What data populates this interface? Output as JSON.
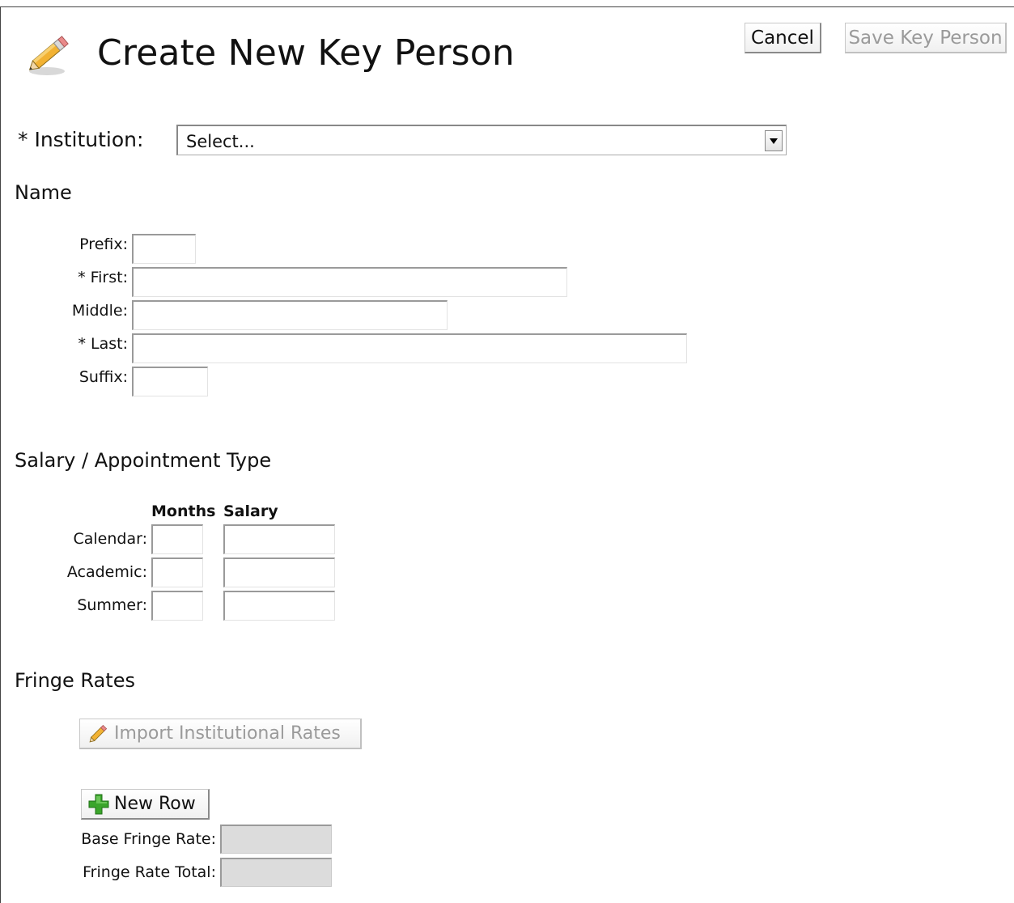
{
  "header": {
    "title": "Create New Key Person",
    "cancel_label": "Cancel",
    "save_label": "Save Key Person"
  },
  "institution": {
    "label": "* Institution:",
    "selected": "Select..."
  },
  "name_section": {
    "heading": "Name",
    "fields": {
      "prefix": "Prefix:",
      "first": "* First:",
      "middle": "Middle:",
      "last": "* Last:",
      "suffix": "Suffix:"
    }
  },
  "salary_section": {
    "heading": "Salary / Appointment Type",
    "col_months": "Months",
    "col_salary": "Salary",
    "rows": {
      "calendar": "Calendar:",
      "academic": "Academic:",
      "summer": "Summer:"
    }
  },
  "fringe_section": {
    "heading": "Fringe Rates",
    "import_label": "Import Institutional Rates",
    "new_row_label": "New Row",
    "base_rate_label": "Base Fringe Rate:",
    "rate_total_label": "Fringe Rate Total:"
  },
  "colors": {
    "disabled_text": "#9a9a9a",
    "plus_icon": "#3aa52a",
    "readonly_field": "#dcdcdc"
  }
}
